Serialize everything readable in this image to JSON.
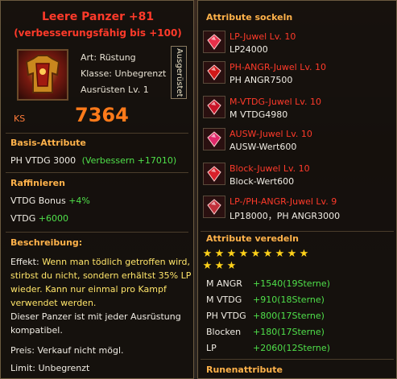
{
  "item": {
    "name": "Leere Panzer  +81",
    "upgrade_note": "(verbesserungsfähig bis +100)",
    "icon": "armor-icon",
    "type": "Art: Rüstung",
    "class": "Klasse: Unbegrenzt",
    "equip_level": "Ausrüsten Lv. 1",
    "equipped_tag": "Ausgerüstet",
    "ks_label": "KS",
    "ks_value": "7364"
  },
  "basis": {
    "title": "Basis-Attribute",
    "stat": "PH VTDG 3000",
    "upgrade": "(Verbessern +17010)"
  },
  "raffinieren": {
    "title": "Raffinieren",
    "bonus_label": "VTDG Bonus",
    "bonus_value": "+4%",
    "vtdg_label": "VTDG",
    "vtdg_value": "+6000"
  },
  "description": {
    "title": "Beschreibung:",
    "effect_prefix": "Effekt:",
    "effect_text": "Wenn man tödlich getroffen wird, stirbst du nicht, sondern erhältst 35% LP wieder. Kann nur einmal pro Kampf verwendet werden.",
    "compat": "Dieser Panzer ist mit jeder Ausrüstung kompatibel.",
    "price": "Preis: Verkauf nicht mögl.",
    "limit": "Limit: Unbegrenzt"
  },
  "sockets": {
    "title": "Attribute sockeln",
    "gems": [
      {
        "name": "LP-Juwel Lv. 10",
        "stat": "LP24000",
        "icon": "diamond-gem-icon",
        "color": "#e8304a"
      },
      {
        "name": "PH-ANGR-Juwel Lv. 10",
        "stat": "PH ANGR7500",
        "icon": "oval-gem-icon",
        "color": "#d01818"
      },
      {
        "name": "M-VTDG-Juwel Lv. 10",
        "stat": "M VTDG4980",
        "icon": "crystal-gem-icon",
        "color": "#c81428"
      },
      {
        "name": "AUSW-Juwel Lv. 10",
        "stat": "AUSW-Wert600",
        "icon": "heart-gem-icon",
        "color": "#e0286a"
      },
      {
        "name": "Block-Juwel Lv. 10",
        "stat": "Block-Wert600",
        "icon": "round-gem-icon",
        "color": "#d8202a"
      },
      {
        "name": "LP-/PH-ANGR-Juwel Lv. 9",
        "stat": "LP18000，PH ANGR3000",
        "icon": "cushion-gem-icon",
        "color": "#c0303a"
      }
    ]
  },
  "refine": {
    "title": "Attribute veredeln",
    "star_count": 12,
    "rows": [
      {
        "label": "M ANGR",
        "value": "+1540(19Sterne)"
      },
      {
        "label": "M VTDG",
        "value": "+910(18Sterne)"
      },
      {
        "label": "PH VTDG",
        "value": "+800(17Sterne)"
      },
      {
        "label": "Blocken",
        "value": "+180(17Sterne)"
      },
      {
        "label": "LP",
        "value": "+2060(12Sterne)"
      }
    ]
  },
  "rune": {
    "title": "Runenattribute"
  }
}
